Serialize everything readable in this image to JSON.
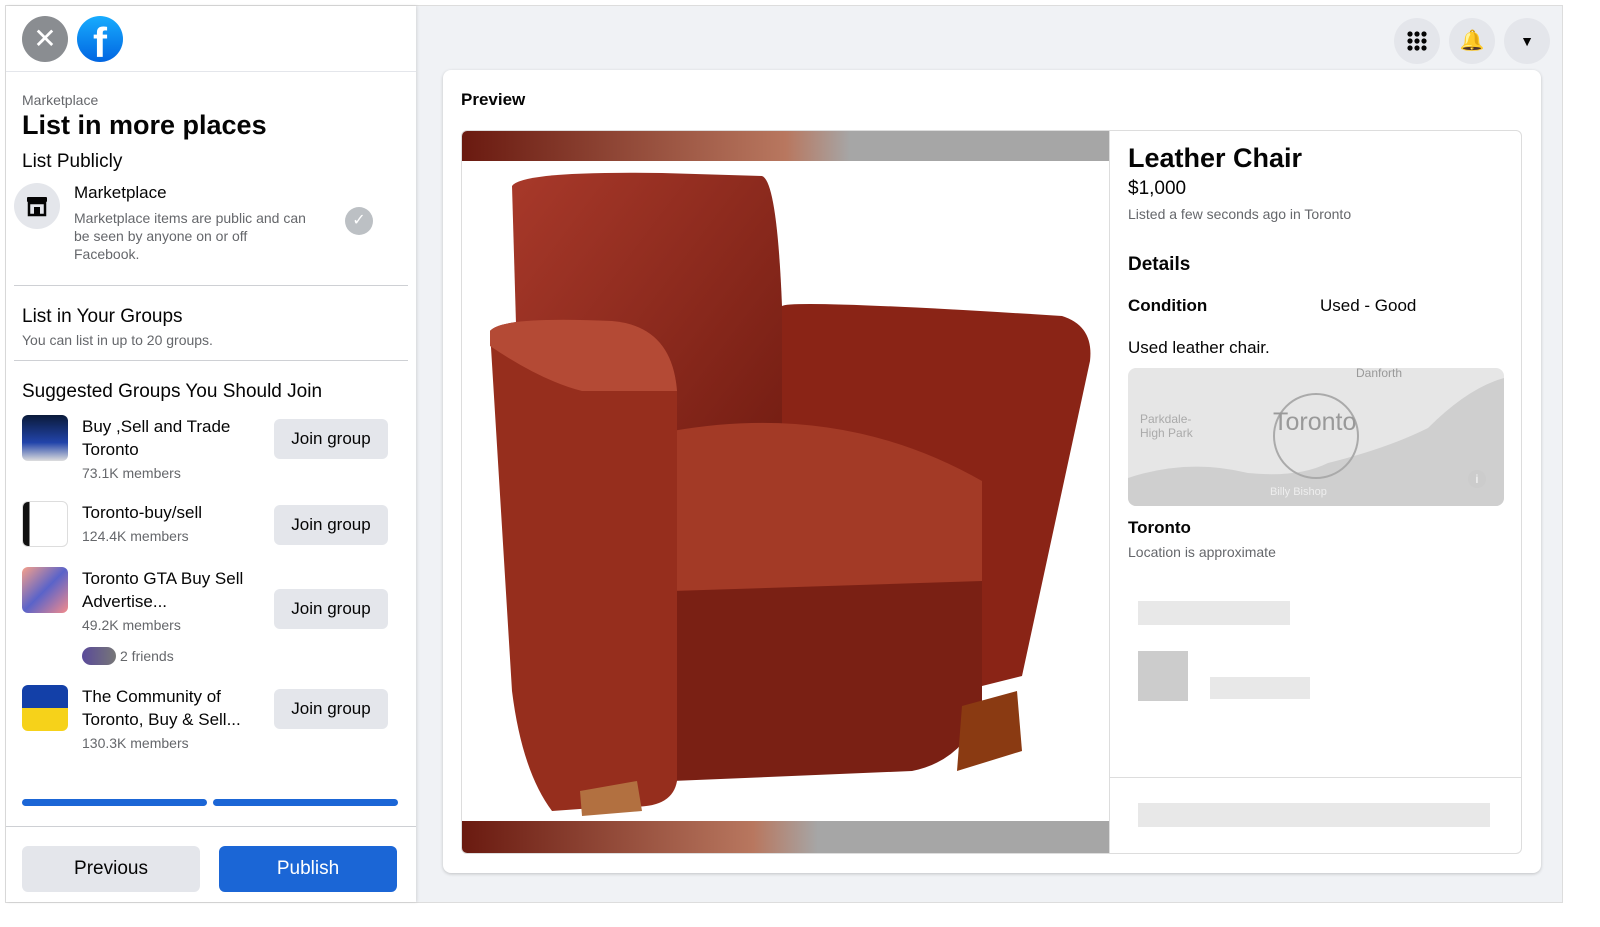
{
  "header": {
    "close_icon": "close-icon",
    "logo": "facebook-logo"
  },
  "left": {
    "breadcrumb": "Marketplace",
    "title": "List in more places",
    "list_publicly": "List Publicly",
    "marketplace": {
      "name": "Marketplace",
      "desc": "Marketplace items are public and can be seen by anyone on or off Facebook."
    },
    "groups_title": "List in Your Groups",
    "groups_sub": "You can list in up to 20 groups.",
    "suggested_title": "Suggested Groups You Should Join",
    "groups": [
      {
        "name": "Buy ,Sell and Trade Toronto",
        "members": "73.1K members",
        "button": "Join group"
      },
      {
        "name": "Toronto-buy/sell",
        "members": "124.4K members",
        "button": "Join group"
      },
      {
        "name": "Toronto GTA Buy Sell Advertise...",
        "members": "49.2K members",
        "friends": "2 friends",
        "button": "Join group"
      },
      {
        "name": "The Community of Toronto, Buy & Sell...",
        "members": "130.3K members",
        "button": "Join group"
      }
    ],
    "previous": "Previous",
    "publish": "Publish"
  },
  "preview": {
    "label": "Preview",
    "title": "Leather Chair",
    "price": "$1,000",
    "listed": "Listed a few seconds ago in Toronto",
    "details": "Details",
    "condition_label": "Condition",
    "condition_value": "Used - Good",
    "description": "Used leather chair.",
    "map": {
      "city": "Toronto",
      "labels": [
        "Danforth",
        "Parkdale-High Park",
        "Billy Bishop"
      ]
    },
    "location": "Toronto",
    "location_note": "Location is approximate"
  },
  "colors": {
    "accent": "#1b66d6",
    "chair": "#8b2416"
  }
}
